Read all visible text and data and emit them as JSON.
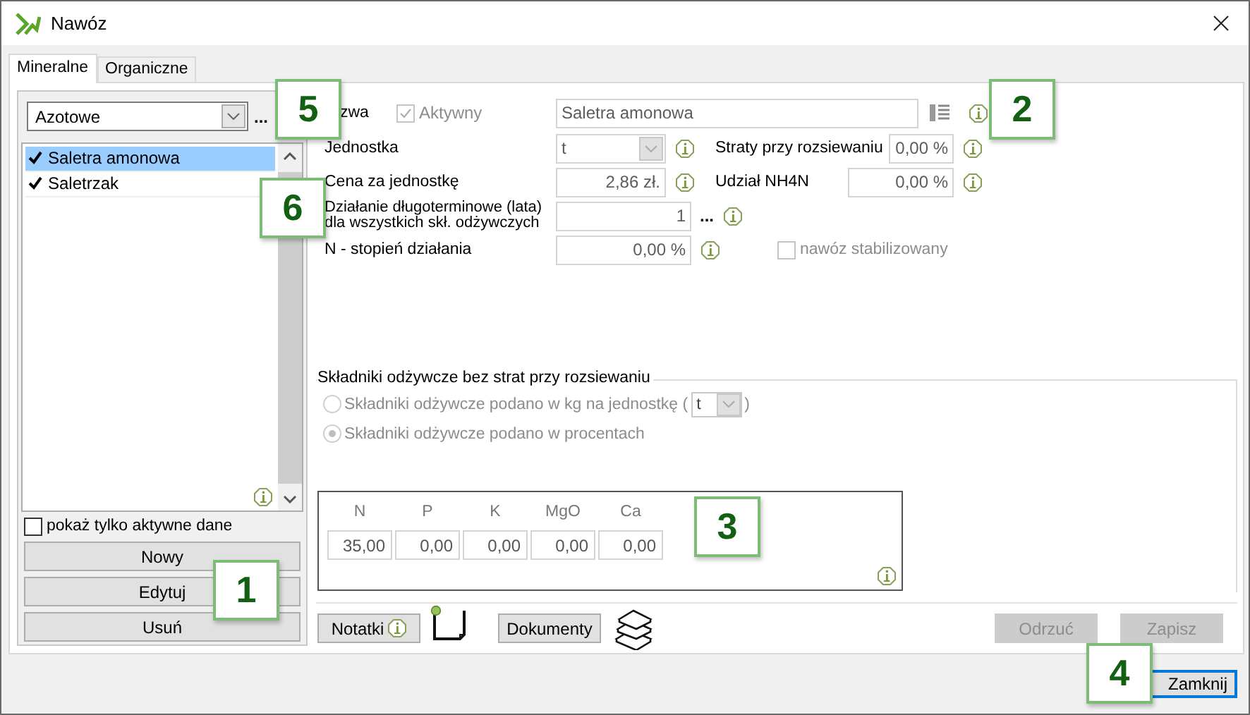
{
  "window": {
    "title": "Nawóz"
  },
  "tabs": [
    {
      "label": "Mineralne",
      "selected": true
    },
    {
      "label": "Organiczne",
      "selected": false
    }
  ],
  "left_panel": {
    "category": "Azotowe",
    "more": "...",
    "items": [
      {
        "label": "Saletra amonowa",
        "checked": true,
        "selected": true
      },
      {
        "label": "Saletrzak",
        "checked": true,
        "selected": false
      }
    ],
    "show_active_only": {
      "label": "pokaż tylko aktywne dane",
      "checked": false
    },
    "buttons": [
      "Nowy",
      "Edytuj",
      "Usuń"
    ]
  },
  "form": {
    "name": {
      "label": "zwa",
      "value": "Saletra amonowa"
    },
    "active": {
      "label": "Aktywny",
      "checked": true,
      "disabled": true
    },
    "unit": {
      "label": "Jednostka",
      "value": "t"
    },
    "losses": {
      "label": "Straty przy rozsiewaniu",
      "value": "0,00 %"
    },
    "price": {
      "label": "Cena za jednostkę",
      "value": "2,86 zł."
    },
    "nh4n": {
      "label": "Udział NH4N",
      "value": "0,00 %"
    },
    "long_term": {
      "label_lines": [
        "Działanie długoterminowe (lata)",
        "dla wszystkich skł. odżywczych"
      ],
      "value": "1",
      "more": "..."
    },
    "n_rate": {
      "label": "N - stopień działania",
      "value": "0,00 %"
    },
    "stabilized": {
      "label": "nawóz stabilizowany",
      "checked": false,
      "disabled": true
    }
  },
  "nutrients": {
    "title": "Składniki odżywcze bez strat przy rozsiewaniu",
    "disabled": true,
    "options": [
      {
        "label": "Składniki odżywcze podano w kg na jednostkę (",
        "unit": "t",
        "suffix": ")",
        "selected": false
      },
      {
        "label": "Składniki odżywcze podano w procentach",
        "selected": true
      }
    ],
    "columns": [
      {
        "label": "N",
        "value": "35,00"
      },
      {
        "label": "P",
        "value": "0,00"
      },
      {
        "label": "K",
        "value": "0,00"
      },
      {
        "label": "MgO",
        "value": "0,00"
      },
      {
        "label": "Ca",
        "value": "0,00"
      }
    ]
  },
  "actions": {
    "notes": "Notatki",
    "documents": "Dokumenty",
    "discard": {
      "label": "Odrzuć",
      "disabled": true
    },
    "save": {
      "label": "Zapisz",
      "disabled": true
    }
  },
  "close_button": "Zamknij",
  "callouts": [
    "5",
    "2",
    "6",
    "3",
    "1",
    "4"
  ]
}
